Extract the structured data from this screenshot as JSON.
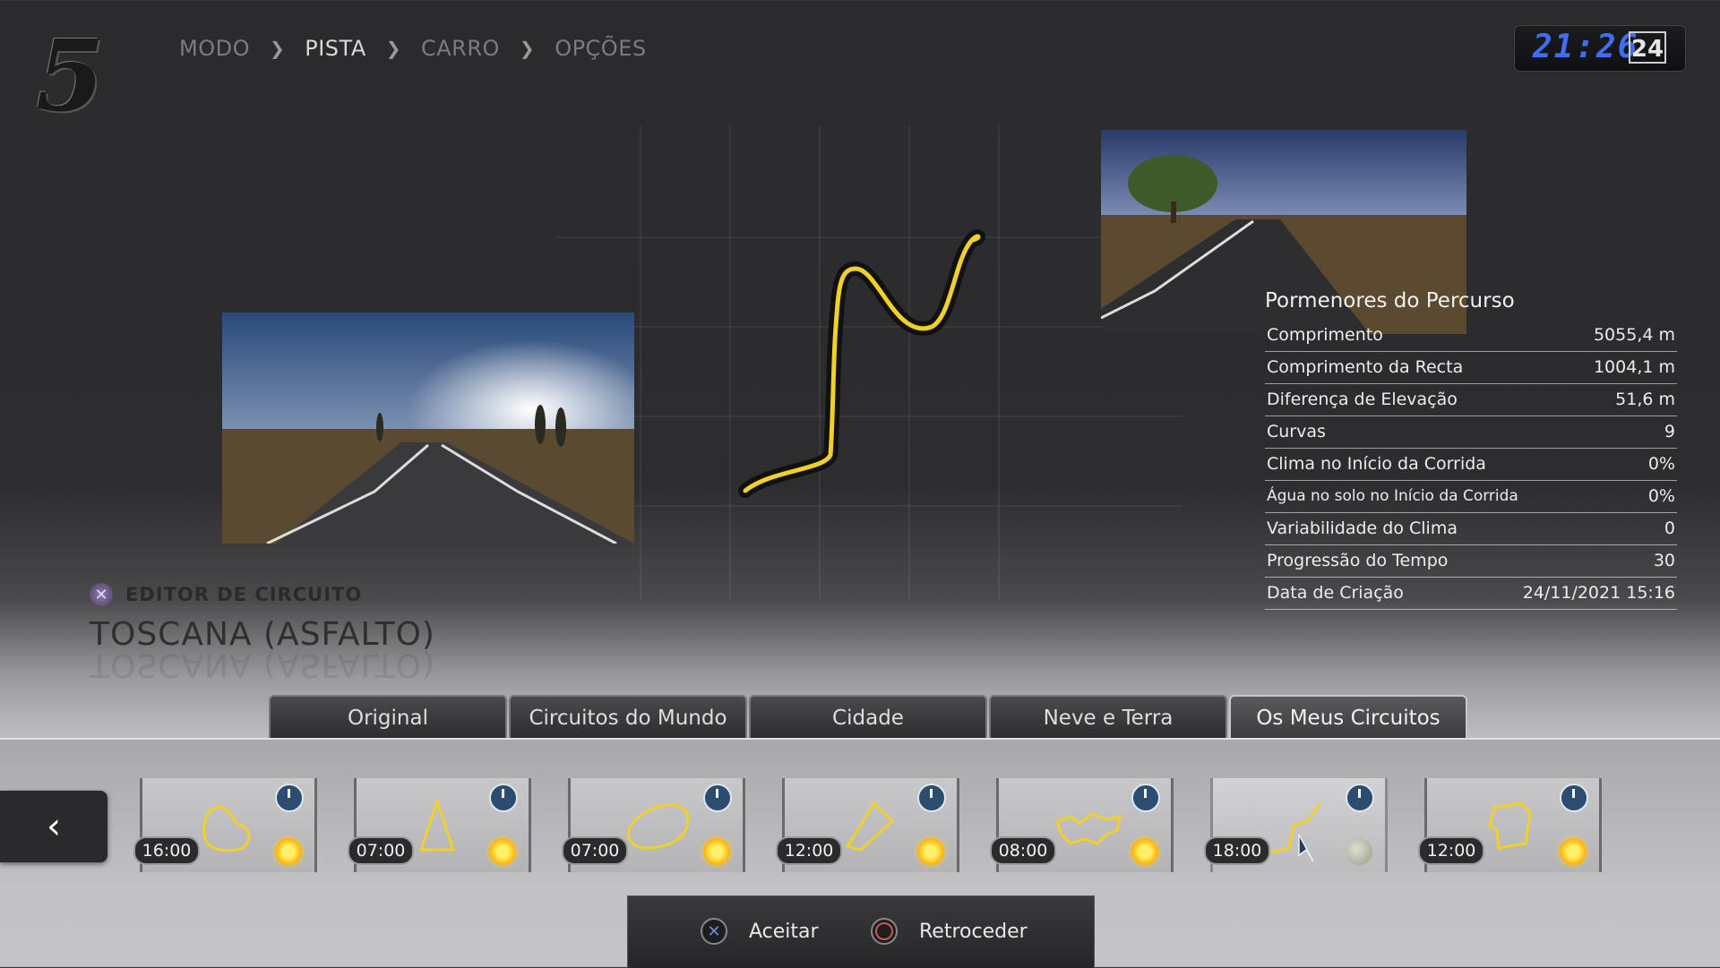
{
  "logo": {
    "text": "5"
  },
  "breadcrumb": [
    {
      "label": "MODO"
    },
    {
      "label": "PISTA"
    },
    {
      "label": "CARRO"
    },
    {
      "label": "OPÇÕES"
    }
  ],
  "clock": {
    "time": "21:26",
    "day": "24"
  },
  "details": {
    "title": "Pormenores do Percurso",
    "rows": [
      {
        "label": "Comprimento",
        "value": "5055,4 m"
      },
      {
        "label": "Comprimento da Recta",
        "value": "1004,1 m"
      },
      {
        "label": "Diferença de Elevação",
        "value": "51,6 m"
      },
      {
        "label": "Curvas",
        "value": "9"
      },
      {
        "label": "Clima no Início da Corrida",
        "value": "0%"
      },
      {
        "label": "Água no solo no Início da Corrida",
        "value": "0%"
      },
      {
        "label": "Variabilidade do Clima",
        "value": "0"
      },
      {
        "label": "Progressão do Tempo",
        "value": "30"
      },
      {
        "label": "Data de Criação",
        "value": "24/11/2021 15:16"
      }
    ]
  },
  "editor": {
    "label": "EDITOR DE CIRCUITO",
    "track_name": "TOSCANA (ASFALTO)"
  },
  "tabs": [
    {
      "label": "Original"
    },
    {
      "label": "Circuitos do Mundo"
    },
    {
      "label": "Cidade"
    },
    {
      "label": "Neve e Terra"
    },
    {
      "label": "Os Meus Circuitos"
    }
  ],
  "cards": [
    {
      "time": "16:00",
      "weather": "sun-icon"
    },
    {
      "time": "07:00",
      "weather": "sun-icon"
    },
    {
      "time": "07:00",
      "weather": "sun-icon"
    },
    {
      "time": "12:00",
      "weather": "sun-icon"
    },
    {
      "time": "08:00",
      "weather": "sun-icon"
    },
    {
      "time": "18:00",
      "weather": "moon-icon"
    },
    {
      "time": "12:00",
      "weather": "sun-icon"
    }
  ],
  "buttons": {
    "accept": "Aceitar",
    "back": "Retroceder"
  },
  "colors": {
    "track": "#f2d02a",
    "clock_digits": "#3e6ff0"
  }
}
